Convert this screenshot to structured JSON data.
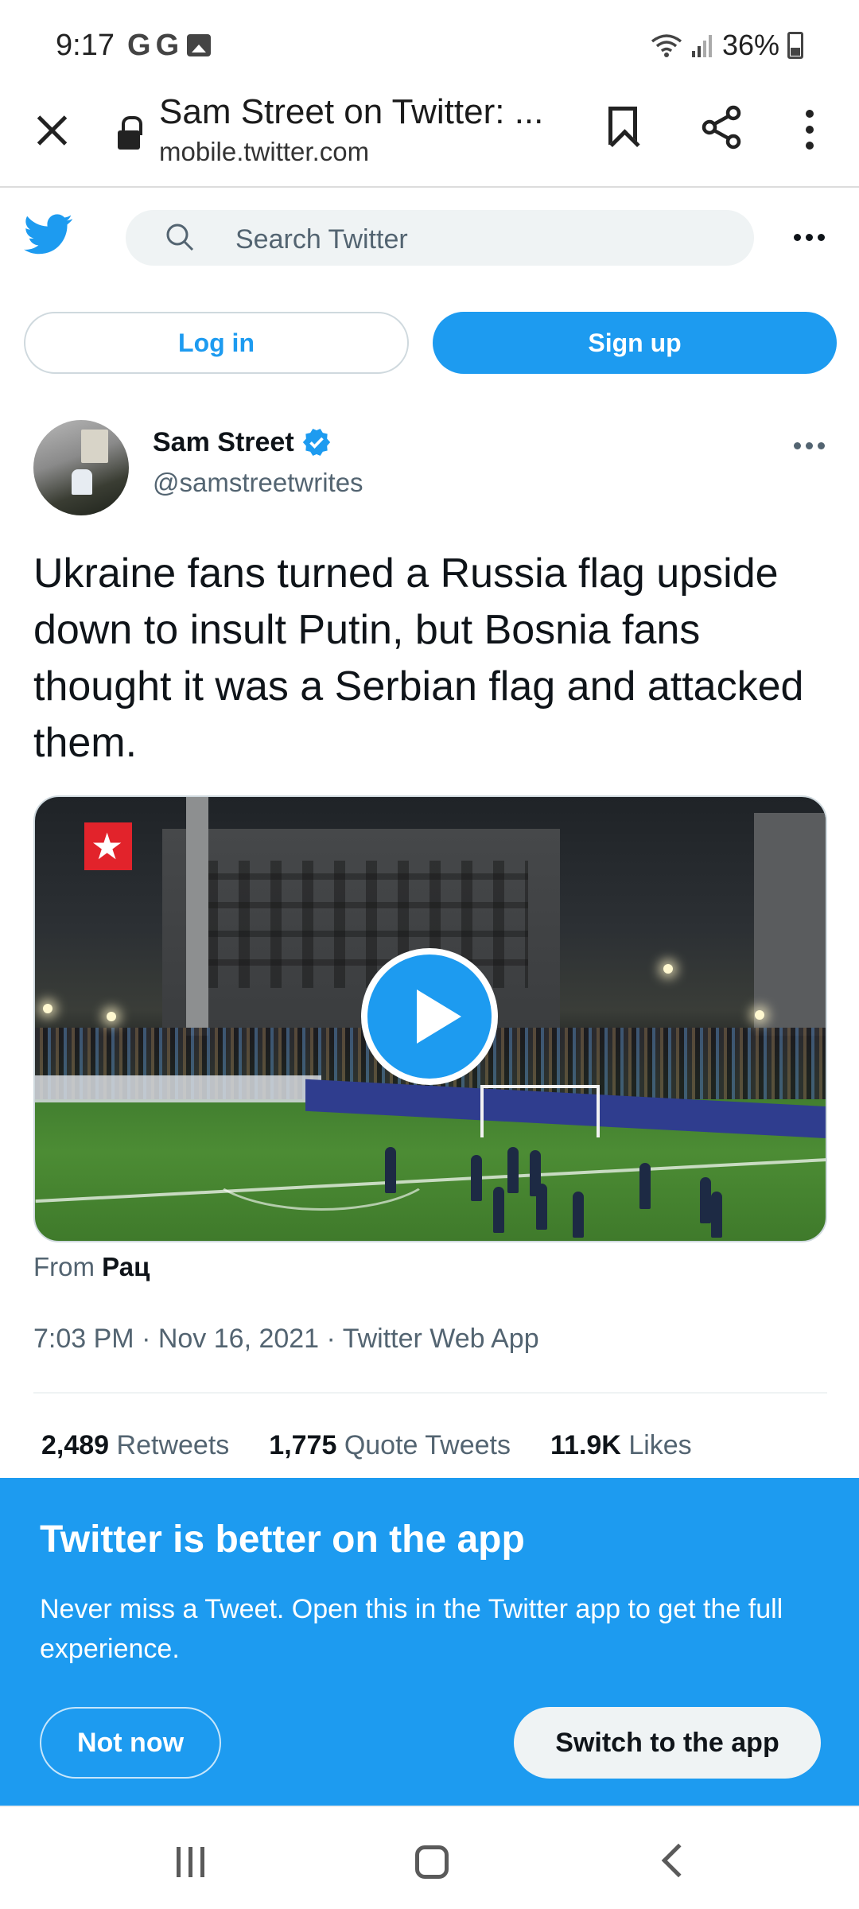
{
  "status_bar": {
    "time": "9:17",
    "left_icons": [
      "G",
      "G"
    ],
    "battery": "36%"
  },
  "browser": {
    "title": "Sam Street on Twitter: ...",
    "url": "mobile.twitter.com"
  },
  "twitter_header": {
    "search_placeholder": "Search Twitter"
  },
  "auth": {
    "login_label": "Log in",
    "signup_label": "Sign up"
  },
  "tweet": {
    "author_name": "Sam Street",
    "author_handle": "@samstreetwrites",
    "text": "Ukraine fans turned a Russia flag upside down to insult Putin, but Bosnia fans thought it was a Serbian flag and attacked them.",
    "from_prefix": "From",
    "from_source": "Рац",
    "meta": "7:03 PM · Nov 16, 2021 · Twitter Web App",
    "stats": [
      {
        "count": "2,489",
        "label": "Retweets"
      },
      {
        "count": "1,775",
        "label": "Quote Tweets"
      },
      {
        "count": "11.9K",
        "label": "Likes"
      }
    ]
  },
  "app_banner": {
    "title": "Twitter is better on the app",
    "text": "Never miss a Tweet. Open this in the Twitter app to get the full experience.",
    "not_now_label": "Not now",
    "switch_label": "Switch to the app"
  },
  "colors": {
    "twitter_blue": "#1d9bf0",
    "text_primary": "#0f1419",
    "text_secondary": "#536471",
    "search_bg": "#eff3f4"
  },
  "icons": {
    "close": "close-icon",
    "lock": "lock-icon",
    "bookmark": "bookmark-icon",
    "share": "share-icon",
    "menu": "kebab-menu-icon",
    "logo": "twitter-bird-icon",
    "search": "search-icon",
    "verified": "verified-badge-icon",
    "play": "play-icon"
  }
}
